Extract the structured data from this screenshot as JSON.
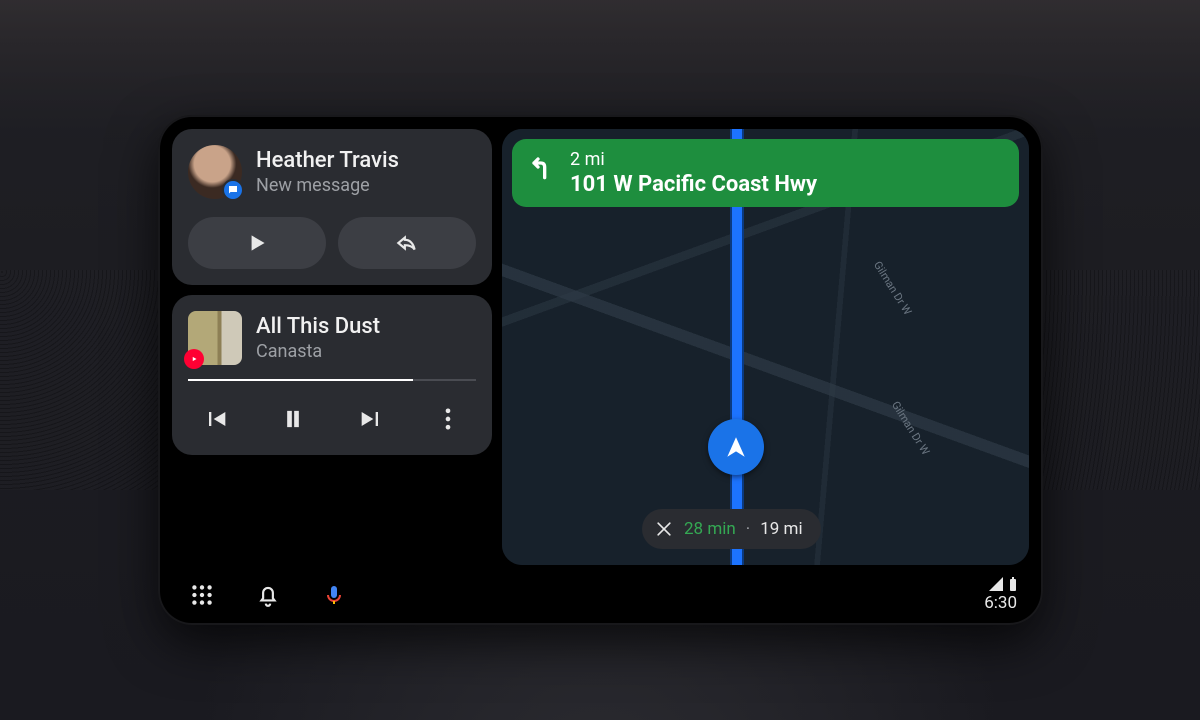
{
  "message_card": {
    "sender": "Heather Travis",
    "subtitle": "New message"
  },
  "media_card": {
    "track": "All This Dust",
    "artist": "Canasta",
    "progress_pct": 78
  },
  "navigation": {
    "distance": "2 mi",
    "road": "101 W Pacific Coast Hwy",
    "eta_time": "28 min",
    "eta_distance": "19 mi",
    "street_label_1": "Gilman Dr W",
    "street_label_2": "Gilman Dr W"
  },
  "sysbar": {
    "clock": "6:30"
  }
}
